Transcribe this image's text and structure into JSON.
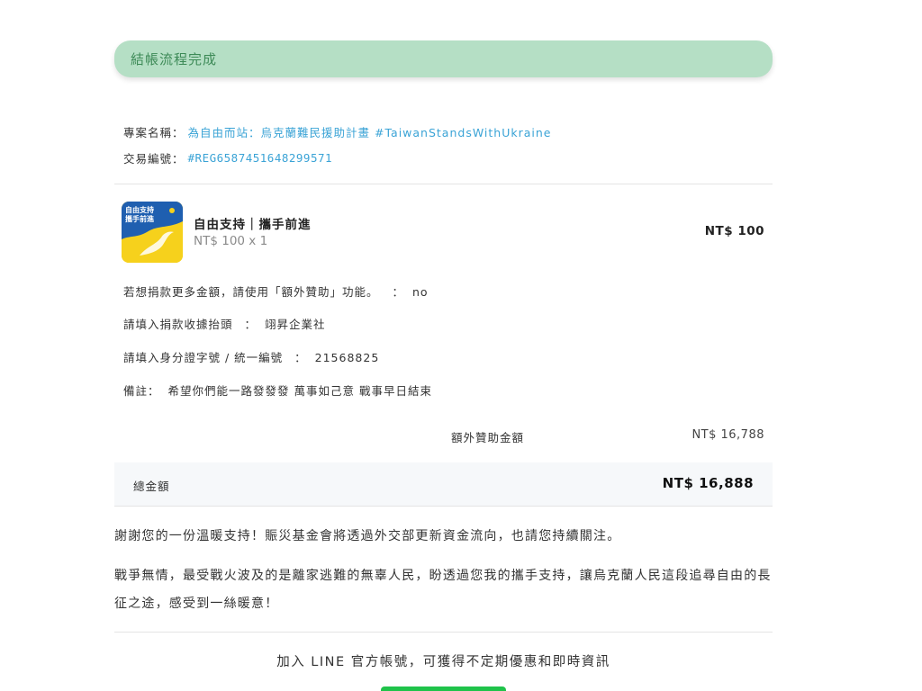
{
  "banner": {
    "text": "結帳流程完成"
  },
  "meta": {
    "project_label": "專案名稱：",
    "project_value": "為自由而站：烏克蘭難民援助計畫 #TaiwanStandsWithUkraine",
    "txn_label": "交易編號：",
    "txn_value": "#REG6587451648299571"
  },
  "item": {
    "thumb_text_line1": "自由支持",
    "thumb_text_line2": "攜手前進",
    "title": "自由支持｜攜手前進",
    "sub": "NT$ 100 x 1",
    "price": "NT$ 100"
  },
  "answers": [
    {
      "q": "若想捐款更多金額，請使用「額外贊助」功能。",
      "a": "no"
    },
    {
      "q": "請填入捐款收據抬頭",
      "a": "翊昇企業社"
    },
    {
      "q": "請填入身分證字號 / 統一編號",
      "a": "21568825"
    },
    {
      "q": "備註：",
      "a": "希望你們能一路發發發 萬事如己意 戰事早日結束"
    }
  ],
  "summary": {
    "extra_label": "額外贊助金額",
    "extra_value": "NT$ 16,788"
  },
  "total": {
    "label": "總金額",
    "value": "NT$ 16,888"
  },
  "thanks": {
    "p1": "謝謝您的一份溫暖支持！賑災基金會將透過外交部更新資金流向，也請您持續關注。",
    "p2": "戰爭無情，最受戰火波及的是離家逃難的無辜人民，盼透過您我的攜手支持，讓烏克蘭人民這段追尋自由的長征之途，感受到一絲暖意！"
  },
  "line": {
    "cta": "加入 LINE 官方帳號，可獲得不定期優惠和即時資訊"
  },
  "colors": {
    "banner_bg": "#b5dfc5",
    "banner_text": "#3d8a57",
    "link": "#3aa3d6",
    "line_green": "#1fc34a"
  }
}
